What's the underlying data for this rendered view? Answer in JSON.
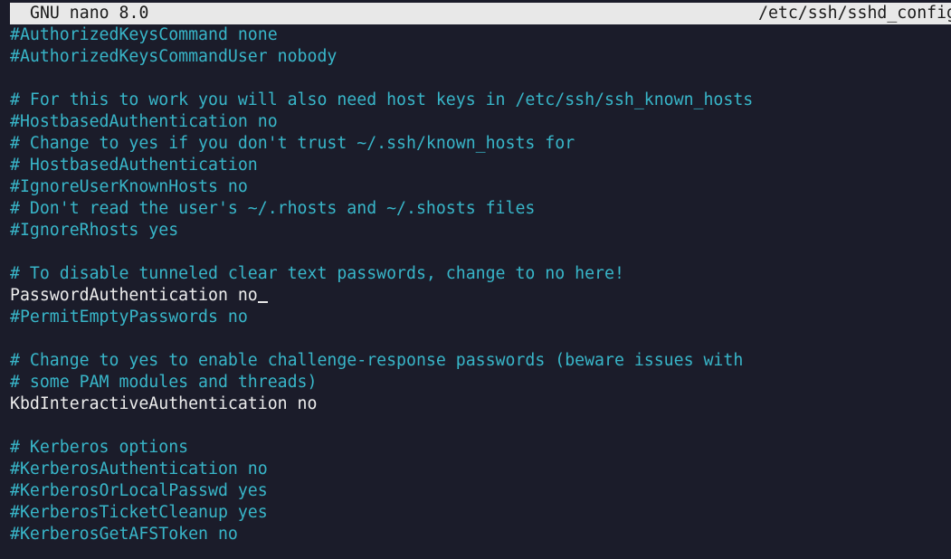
{
  "titlebar": {
    "app": "GNU nano 8.0",
    "file": "/etc/ssh/sshd_config"
  },
  "colors": {
    "background": "#1b1c2a",
    "comment": "#38b6c9",
    "code": "#ededed",
    "titlebar_bg": "#e8e8e8"
  },
  "lines": [
    {
      "text": "#AuthorizedKeysCommand none",
      "type": "comment"
    },
    {
      "text": "#AuthorizedKeysCommandUser nobody",
      "type": "comment"
    },
    {
      "text": "",
      "type": "blank"
    },
    {
      "text": "# For this to work you will also need host keys in /etc/ssh/ssh_known_hosts",
      "type": "comment"
    },
    {
      "text": "#HostbasedAuthentication no",
      "type": "comment"
    },
    {
      "text": "# Change to yes if you don't trust ~/.ssh/known_hosts for",
      "type": "comment"
    },
    {
      "text": "# HostbasedAuthentication",
      "type": "comment"
    },
    {
      "text": "#IgnoreUserKnownHosts no",
      "type": "comment"
    },
    {
      "text": "# Don't read the user's ~/.rhosts and ~/.shosts files",
      "type": "comment"
    },
    {
      "text": "#IgnoreRhosts yes",
      "type": "comment"
    },
    {
      "text": "",
      "type": "blank"
    },
    {
      "text": "# To disable tunneled clear text passwords, change to no here!",
      "type": "comment"
    },
    {
      "text": "PasswordAuthentication no",
      "type": "code",
      "cursor": true
    },
    {
      "text": "#PermitEmptyPasswords no",
      "type": "comment"
    },
    {
      "text": "",
      "type": "blank"
    },
    {
      "text": "# Change to yes to enable challenge-response passwords (beware issues with",
      "type": "comment"
    },
    {
      "text": "# some PAM modules and threads)",
      "type": "comment"
    },
    {
      "text": "KbdInteractiveAuthentication no",
      "type": "code"
    },
    {
      "text": "",
      "type": "blank"
    },
    {
      "text": "# Kerberos options",
      "type": "comment"
    },
    {
      "text": "#KerberosAuthentication no",
      "type": "comment"
    },
    {
      "text": "#KerberosOrLocalPasswd yes",
      "type": "comment"
    },
    {
      "text": "#KerberosTicketCleanup yes",
      "type": "comment"
    },
    {
      "text": "#KerberosGetAFSToken no",
      "type": "comment"
    }
  ]
}
